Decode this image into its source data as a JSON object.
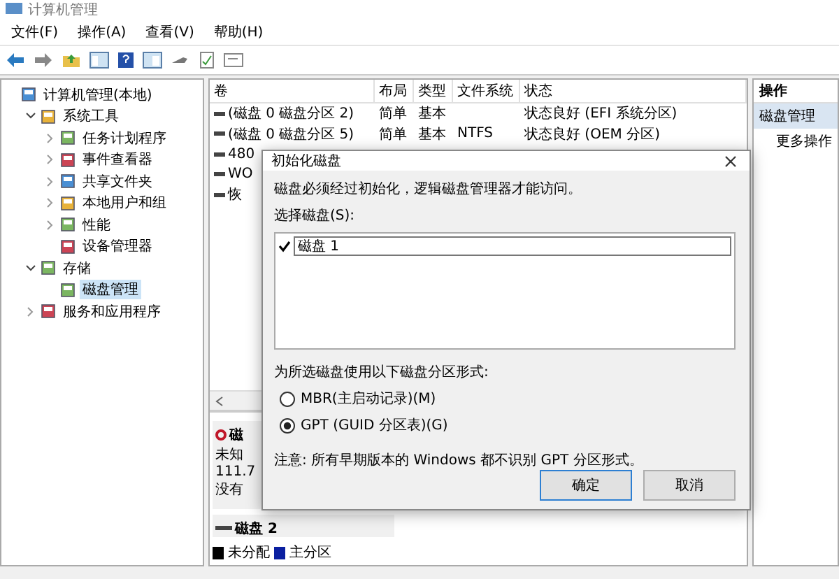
{
  "window": {
    "title": "计算机管理"
  },
  "menu": [
    "文件(F)",
    "操作(A)",
    "查看(V)",
    "帮助(H)"
  ],
  "tree": [
    {
      "label": "计算机管理(本地)",
      "selected": false,
      "children": [
        {
          "label": "系统工具",
          "expanded": true,
          "selected": false,
          "children": [
            {
              "label": "任务计划程序",
              "expanded": false,
              "selected": false
            },
            {
              "label": "事件查看器",
              "expanded": false,
              "selected": false
            },
            {
              "label": "共享文件夹",
              "expanded": false,
              "selected": false
            },
            {
              "label": "本地用户和组",
              "expanded": false,
              "selected": false
            },
            {
              "label": "性能",
              "expanded": false,
              "selected": false
            },
            {
              "label": "设备管理器",
              "selected": false
            }
          ]
        },
        {
          "label": "存储",
          "expanded": true,
          "selected": false,
          "children": [
            {
              "label": "磁盘管理",
              "selected": true
            }
          ]
        },
        {
          "label": "服务和应用程序",
          "expanded": false,
          "selected": false
        }
      ]
    }
  ],
  "table": {
    "columns": [
      "卷",
      "布局",
      "类型",
      "文件系统",
      "状态"
    ],
    "rows": [
      [
        "(磁盘 0 磁盘分区 2)",
        "简单",
        "基本",
        "",
        "状态良好 (EFI 系统分区)"
      ],
      [
        "(磁盘 0 磁盘分区 5)",
        "简单",
        "基本",
        "NTFS",
        "状态良好 (OEM 分区)"
      ],
      [
        "480"
      ],
      [
        "WO"
      ],
      [
        "恢"
      ]
    ]
  },
  "disks": [
    {
      "name": "磁",
      "kind": "unknown",
      "lines": [
        "未知",
        "111.7",
        "没有"
      ]
    },
    {
      "name": "磁盘 2",
      "kind": "basic"
    }
  ],
  "legend": [
    {
      "label": "未分配",
      "color": "#000000"
    },
    {
      "label": "主分区",
      "color": "#0a1fa0"
    }
  ],
  "actions": {
    "header": "操作",
    "items": [
      {
        "label": "磁盘管理",
        "selected": true
      },
      {
        "label": "更多操作",
        "selected": false
      }
    ]
  },
  "dialog": {
    "title": "初始化磁盘",
    "message": "磁盘必须经过初始化，逻辑磁盘管理器才能访问。",
    "select_label": "选择磁盘(S):",
    "disks": [
      {
        "label": "磁盘 1",
        "checked": true
      }
    ],
    "style_label": "为所选磁盘使用以下磁盘分区形式:",
    "options": [
      {
        "label": "MBR(主启动记录)(M)",
        "selected": false
      },
      {
        "label": "GPT (GUID 分区表)(G)",
        "selected": true
      }
    ],
    "note": "注意: 所有早期版本的 Windows 都不识别 GPT 分区形式。",
    "buttons": [
      "确定",
      "取消"
    ]
  }
}
